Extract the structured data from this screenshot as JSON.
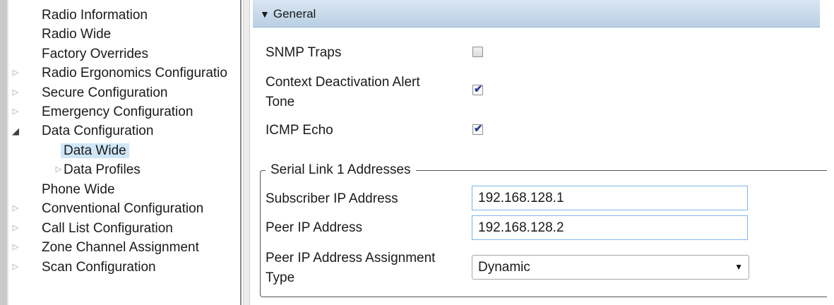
{
  "tree": {
    "items": [
      {
        "label": "Radio Information",
        "arrow": ""
      },
      {
        "label": "Radio Wide",
        "arrow": ""
      },
      {
        "label": "Factory Overrides",
        "arrow": ""
      },
      {
        "label": "Radio Ergonomics Configuratio",
        "arrow": "▷"
      },
      {
        "label": "Secure Configuration",
        "arrow": "▷"
      },
      {
        "label": "Emergency Configuration",
        "arrow": "▷"
      },
      {
        "label": "Data Configuration",
        "arrow": "◢"
      },
      {
        "label": "Data Wide",
        "arrow": ""
      },
      {
        "label": "Data Profiles",
        "arrow": "▷"
      },
      {
        "label": "Phone Wide",
        "arrow": ""
      },
      {
        "label": "Conventional Configuration",
        "arrow": "▷"
      },
      {
        "label": "Call List Configuration",
        "arrow": "▷"
      },
      {
        "label": "Zone Channel Assignment",
        "arrow": "▷"
      },
      {
        "label": "Scan Configuration",
        "arrow": "▷"
      }
    ],
    "selected": "Data Wide"
  },
  "general": {
    "header": "General",
    "header_icon": "▼",
    "snmp_traps": {
      "label": "SNMP Traps",
      "checked": false
    },
    "context_deactivation": {
      "label_line1": "Context Deactivation Alert",
      "label_line2": "Tone",
      "checked": true
    },
    "icmp_echo": {
      "label": "ICMP Echo",
      "checked": true
    }
  },
  "serial_link": {
    "title": "Serial Link 1 Addresses",
    "subscriber_ip": {
      "label": "Subscriber IP Address",
      "value": "192.168.128.1"
    },
    "peer_ip": {
      "label": "Peer IP Address",
      "value": "192.168.128.2"
    },
    "assignment_type": {
      "label_line1": "Peer IP Address Assignment",
      "label_line2": "Type",
      "value": "Dynamic"
    }
  },
  "icons": {
    "check": "checkmark-icon",
    "dropdown": "caret-down-icon"
  }
}
